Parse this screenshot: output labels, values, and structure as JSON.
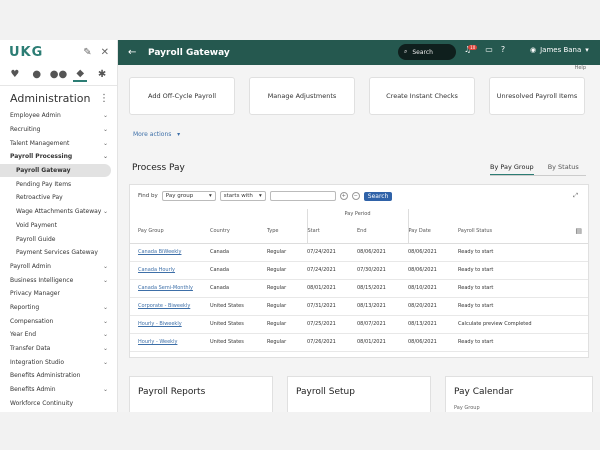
{
  "sidebar": {
    "logo": "UKG",
    "section_title": "Administration",
    "items": [
      {
        "label": "Employee Admin",
        "chevron": true
      },
      {
        "label": "Recruiting",
        "chevron": true
      },
      {
        "label": "Talent Management",
        "chevron": true
      },
      {
        "label": "Payroll Processing",
        "chevron": true,
        "bold": true
      },
      {
        "label": "Payroll Gateway",
        "sub": true,
        "active": true
      },
      {
        "label": "Pending Pay Items",
        "sub": true
      },
      {
        "label": "Retroactive Pay",
        "sub": true
      },
      {
        "label": "Wage Attachments Gateway",
        "sub": true,
        "chevron": true
      },
      {
        "label": "Void Payment",
        "sub": true
      },
      {
        "label": "Payroll Guide",
        "sub": true
      },
      {
        "label": "Payment Services Gateway",
        "sub": true
      },
      {
        "label": "Payroll Admin",
        "chevron": true
      },
      {
        "label": "Business Intelligence",
        "chevron": true
      },
      {
        "label": "Privacy Manager"
      },
      {
        "label": "Reporting",
        "chevron": true
      },
      {
        "label": "Compensation",
        "chevron": true
      },
      {
        "label": "Year End",
        "chevron": true
      },
      {
        "label": "Transfer Data",
        "chevron": true
      },
      {
        "label": "Integration Studio",
        "chevron": true
      },
      {
        "label": "Benefits Administration"
      },
      {
        "label": "Benefits Admin",
        "chevron": true
      },
      {
        "label": "Workforce Continuity"
      }
    ]
  },
  "header": {
    "title": "Payroll Gateway",
    "search_label": "Search",
    "notification_count": "10",
    "user_name": "James Bana"
  },
  "main": {
    "help": "Help",
    "tiles": [
      "Add Off-Cycle Payroll",
      "Manage Adjustments",
      "Create Instant Checks",
      "Unresolved Payroll Items"
    ],
    "more_actions": "More actions",
    "process_pay_title": "Process Pay",
    "tabs": [
      "By Pay Group",
      "By Status"
    ],
    "filter": {
      "find_by": "Find by",
      "field": "Pay group",
      "operator": "starts with",
      "value": "",
      "search_button": "Search"
    },
    "table": {
      "pay_period_label": "Pay Period",
      "columns": [
        "Pay Group",
        "Country",
        "Type",
        "Start",
        "End",
        "Pay Date",
        "Payroll Status"
      ],
      "rows": [
        [
          "Canada BiWeekly",
          "Canada",
          "Regular",
          "07/24/2021",
          "08/06/2021",
          "08/06/2021",
          "Ready to start"
        ],
        [
          "Canada Hourly",
          "Canada",
          "Regular",
          "07/24/2021",
          "07/30/2021",
          "08/06/2021",
          "Ready to start"
        ],
        [
          "Canada Semi-Monthly",
          "Canada",
          "Regular",
          "08/01/2021",
          "08/15/2021",
          "08/10/2021",
          "Ready to start"
        ],
        [
          "Corporate - Biweekly",
          "United States",
          "Regular",
          "07/31/2021",
          "08/13/2021",
          "08/20/2021",
          "Ready to start"
        ],
        [
          "Hourly - Biweekly",
          "United States",
          "Regular",
          "07/25/2021",
          "08/07/2021",
          "08/13/2021",
          "Calculate preview Completed"
        ],
        [
          "Hourly - Weekly",
          "United States",
          "Regular",
          "07/26/2021",
          "08/01/2021",
          "08/06/2021",
          "Ready to start"
        ]
      ]
    },
    "bottom_cards": [
      {
        "title": "Payroll Reports",
        "sub": ""
      },
      {
        "title": "Payroll Setup",
        "sub": ""
      },
      {
        "title": "Pay Calendar",
        "sub": "Pay Group"
      }
    ]
  }
}
